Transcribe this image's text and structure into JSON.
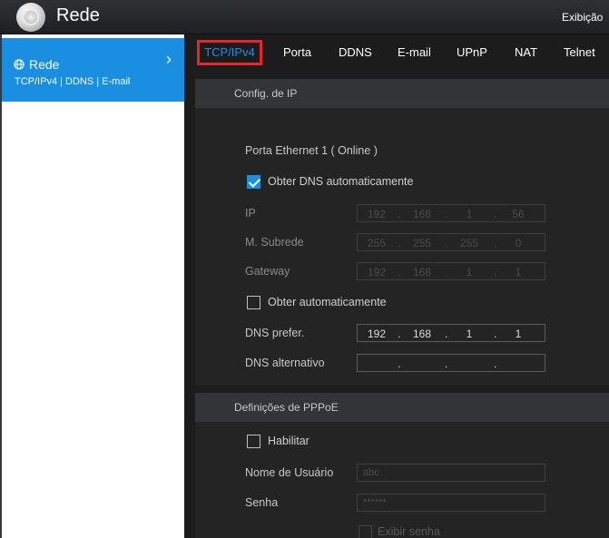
{
  "app": {
    "title": "Rede",
    "top_right": "Exibição"
  },
  "sidebar": {
    "item": {
      "title": "Rede",
      "subtitle": "TCP/IPv4 | DDNS | E-mail"
    }
  },
  "tabs": [
    "TCP/IPv4",
    "Porta",
    "DDNS",
    "E-mail",
    "UPnP",
    "NAT",
    "Telnet"
  ],
  "active_tab": "TCP/IPv4",
  "ip_config": {
    "header": "Config. de IP"
  },
  "ethernet": {
    "title": "Porta Ethernet 1 ( Online )",
    "dns_auto_label": "Obter DNS automaticamente",
    "dns_auto_checked": true,
    "ip_label": "IP",
    "ip": [
      "192",
      "168",
      "1",
      "56"
    ],
    "subnet_label": "M. Subrede",
    "subnet": [
      "255",
      "255",
      "255",
      "0"
    ],
    "gateway_label": "Gateway",
    "gateway": [
      "192",
      "168",
      "1",
      "1"
    ],
    "obtain_auto_label": "Obter automaticamente",
    "obtain_auto_checked": false,
    "dns_pref_label": "DNS prefer.",
    "dns_pref": [
      "192",
      "168",
      "1",
      "1"
    ],
    "dns_alt_label": "DNS alternativo",
    "dns_alt": [
      "",
      "",
      "",
      ""
    ]
  },
  "pppoe": {
    "header": "Definições de PPPoE",
    "enable_label": "Habilitar",
    "username_label": "Nome de Usuário",
    "username": "abc",
    "password_label": "Senha",
    "password": "******",
    "show_password_label": "Exibir senha"
  }
}
